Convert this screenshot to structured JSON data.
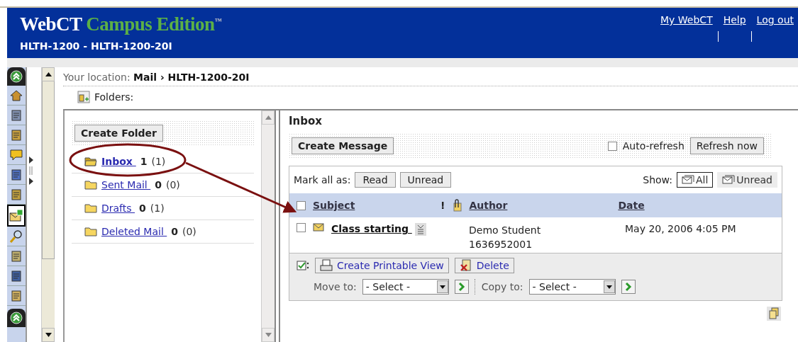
{
  "header": {
    "logo_main": "WebCT",
    "logo_accent": "Campus Edition",
    "logo_mark": "™",
    "course": "HLTH-1200 - HLTH-1200-20I",
    "links": [
      "My WebCT",
      "Help",
      "Log out"
    ]
  },
  "sidebar": {
    "tools": [
      {
        "selected": false
      },
      {
        "selected": false
      },
      {
        "selected": false
      },
      {
        "selected": false
      },
      {
        "selected": false
      },
      {
        "selected": false
      },
      {
        "selected": true
      },
      {
        "selected": false
      },
      {
        "selected": false
      },
      {
        "selected": false
      },
      {
        "selected": false
      }
    ]
  },
  "location": {
    "label": "Your location:",
    "path": "Mail › HLTH-1200-20I"
  },
  "folders_label": "Folders:",
  "folder_pane": {
    "create_button": "Create Folder",
    "folders": [
      {
        "name": "Inbox ",
        "unread": "1",
        "total": "(1)",
        "selected": true
      },
      {
        "name": "Sent Mail ",
        "unread": "0",
        "total": "(0)",
        "selected": false
      },
      {
        "name": "Drafts ",
        "unread": "0",
        "total": "(1)",
        "selected": false
      },
      {
        "name": "Deleted Mail ",
        "unread": "0",
        "total": "(0)",
        "selected": false
      }
    ]
  },
  "inbox": {
    "title": "Inbox",
    "create_button": "Create Message",
    "auto_refresh": {
      "label": "Auto-refresh",
      "checked": false
    },
    "refresh_button": "Refresh now",
    "mark_all_label": "Mark all as:",
    "mark_buttons": [
      "Read",
      "Unread"
    ],
    "show_label": "Show:",
    "show_options": [
      {
        "label": "All",
        "selected": true
      },
      {
        "label": "Unread",
        "selected": false
      }
    ],
    "columns": {
      "select_all_checked": false,
      "subject": "Subject",
      "priority": "!",
      "author": "Author",
      "date": "Date"
    },
    "messages": [
      {
        "checked": false,
        "subject": "Class starting ",
        "author_name": "Demo Student",
        "author_number": "1636952001",
        "date": "May 20, 2006 4:05 PM"
      }
    ],
    "actions": [
      "Create Printable View",
      "Delete"
    ],
    "move_label": "Move to:",
    "move_select": "- Select -",
    "copy_label": "Copy to:",
    "copy_select": "- Select -"
  }
}
